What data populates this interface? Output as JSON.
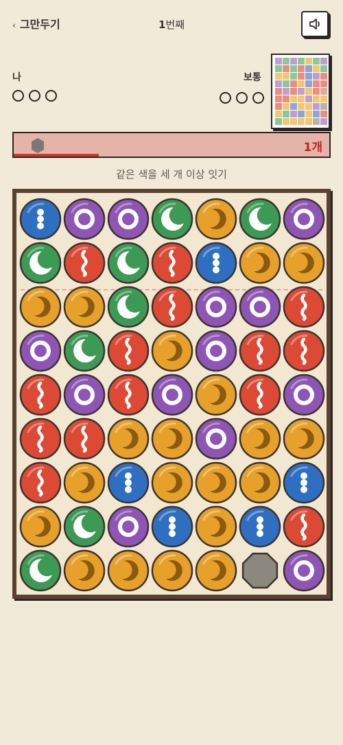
{
  "header": {
    "quit_label": "그만두기",
    "round_number": "1",
    "round_suffix": "번째"
  },
  "icons": {
    "back": "chevron-left-icon",
    "sound": "speaker-icon"
  },
  "player": {
    "label": "나",
    "lives": 3
  },
  "opponent": {
    "label": "보통",
    "lives": 3
  },
  "progress": {
    "count_label": "1개",
    "fraction": 0.27
  },
  "instruction": "같은 색을 세 개 이상 잇기",
  "colors": {
    "background": "#f2ead9",
    "board_frame": "#5a4233",
    "blue": "#2f6fc1",
    "purple": "#8e55b5",
    "green": "#3c9a55",
    "orange": "#e7a12a",
    "red": "#dc4a35",
    "stone": "#8c877f",
    "accent_red": "#b8291e"
  },
  "mini_board": {
    "rows": [
      "pgpgogp",
      "grgrbog",
      "oogrbpr",
      "pgrobrr",
      "rprpork",
      "rroopoo",
      "robooph",
      "ogpbobr",
      "goooosp"
    ]
  },
  "board": {
    "rows": [
      "bppgogp",
      "grgrboo",
      "oogrppr",
      "pgroprr",
      "rprporp",
      "rroopoo",
      "robooob",
      "ogpbobr",
      "goooosp"
    ],
    "legend": {
      "b": "blue-dots",
      "p": "purple-ring",
      "g": "green-moon",
      "o": "orange-swirl",
      "r": "red-wave",
      "s": "gray-stone"
    }
  }
}
